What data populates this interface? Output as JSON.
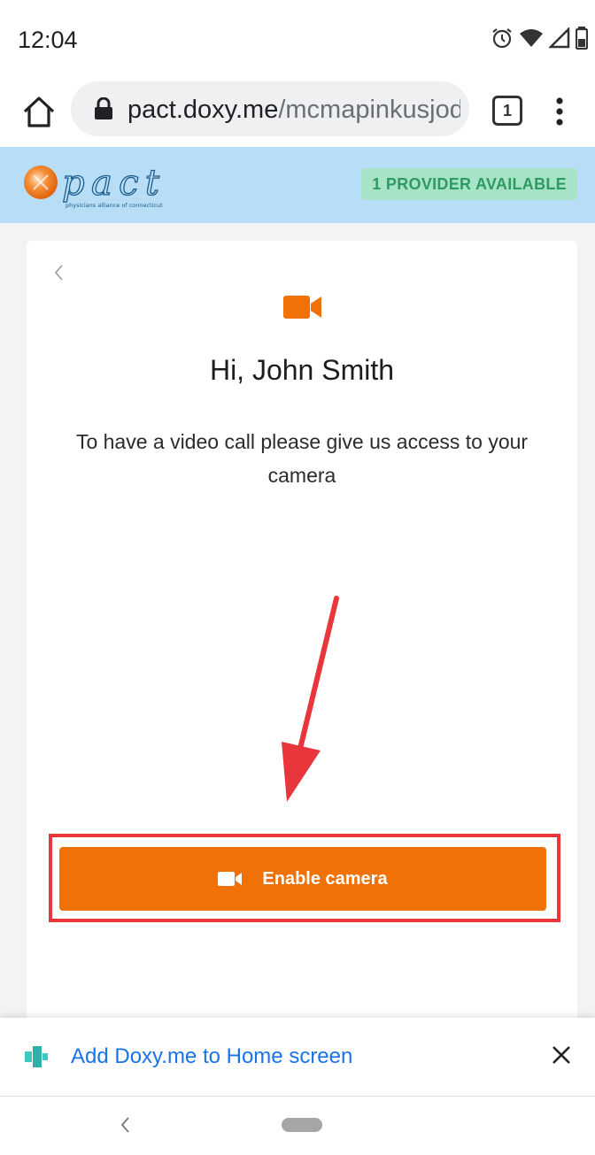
{
  "status_bar": {
    "time": "12:04",
    "icons": [
      "alarm-icon",
      "wifi-icon",
      "signal-icon",
      "battery-icon"
    ]
  },
  "browser": {
    "url_domain": "pact.doxy.me",
    "url_path": "/mcmapinkusjodiapr",
    "tab_count": "1",
    "icons": [
      "home-icon",
      "lock-icon",
      "tab-switcher-icon",
      "overflow-menu-icon"
    ]
  },
  "site_header": {
    "logo_text": "pact",
    "logo_tagline": "physicians alliance of connecticut",
    "provider_badge": "1 PROVIDER AVAILABLE"
  },
  "card": {
    "greeting": "Hi, John Smith",
    "message": "To have a video call please give us access to your camera",
    "button_label": "Enable camera",
    "icons": [
      "back-chevron-icon",
      "video-camera-icon"
    ]
  },
  "a2hs_banner": {
    "label": "Add Doxy.me to Home screen",
    "icons": [
      "doxy-app-icon",
      "close-icon"
    ]
  },
  "colors": {
    "accent_orange": "#f07105",
    "header_blue": "#b8ddf6",
    "badge_green_bg": "#a7e3c7",
    "badge_green_text": "#2f9a62",
    "annotation_red": "#e8363c",
    "link_blue": "#1a73e8"
  }
}
